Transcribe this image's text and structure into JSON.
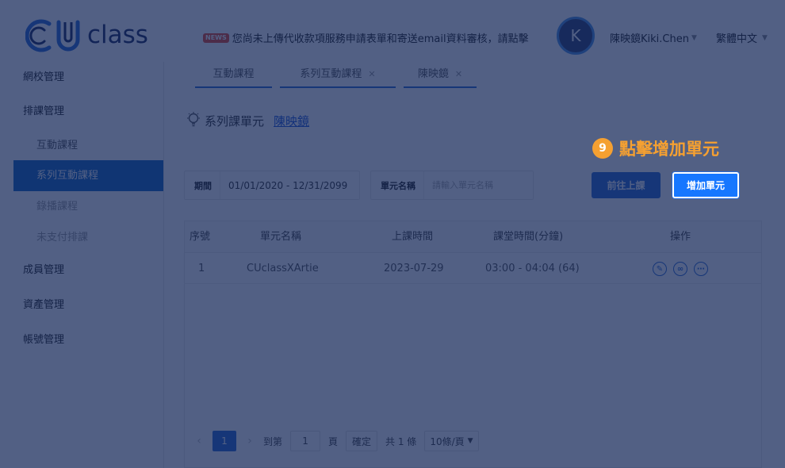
{
  "header": {
    "logo_text": "class",
    "news_badge": "NEWS",
    "news_text": "您尚未上傳代收款項服務申請表單和寄送email資料審核，請點擊",
    "avatar_initial": "K",
    "user_name": "陳映鏡Kiki.Chen",
    "language": "繁體中文"
  },
  "sidebar": {
    "items": [
      {
        "label": "網校管理"
      },
      {
        "label": "排課管理"
      },
      {
        "label": "互動課程"
      },
      {
        "label": "系列互動課程"
      },
      {
        "label": "錄播課程"
      },
      {
        "label": "未支付排課"
      },
      {
        "label": "成員管理"
      },
      {
        "label": "資產管理"
      },
      {
        "label": "帳號管理"
      }
    ]
  },
  "tabs": [
    {
      "label": "互動課程"
    },
    {
      "label": "系列互動課程"
    },
    {
      "label": "陳映鏡"
    }
  ],
  "breadcrumb": {
    "label": "系列課單元",
    "link": "陳映鏡"
  },
  "tutorial": {
    "step": "9",
    "text": "點擊增加單元"
  },
  "filters": {
    "period_label": "期間",
    "period_value": "01/01/2020 - 12/31/2099",
    "name_label": "單元名稱",
    "name_placeholder": "請輸入單元名稱"
  },
  "buttons": {
    "go_class": "前往上課",
    "add_unit": "增加單元"
  },
  "table": {
    "columns": [
      "序號",
      "單元名稱",
      "上課時間",
      "課堂時間(分鐘)",
      "操作"
    ],
    "rows": [
      {
        "index": "1",
        "name": "CUclassXArtie",
        "date": "2023-07-29",
        "duration": "03:00 - 04:04 (64)"
      }
    ]
  },
  "pagination": {
    "current": "1",
    "goto_label": "到第",
    "goto_value": "1",
    "page_label": "頁",
    "confirm": "確定",
    "total": "共 1 條",
    "page_size": "10條/頁"
  },
  "colors": {
    "brand": "#2a6ad3",
    "tutorial": "#f5a031",
    "overlay": "#0f2355"
  }
}
